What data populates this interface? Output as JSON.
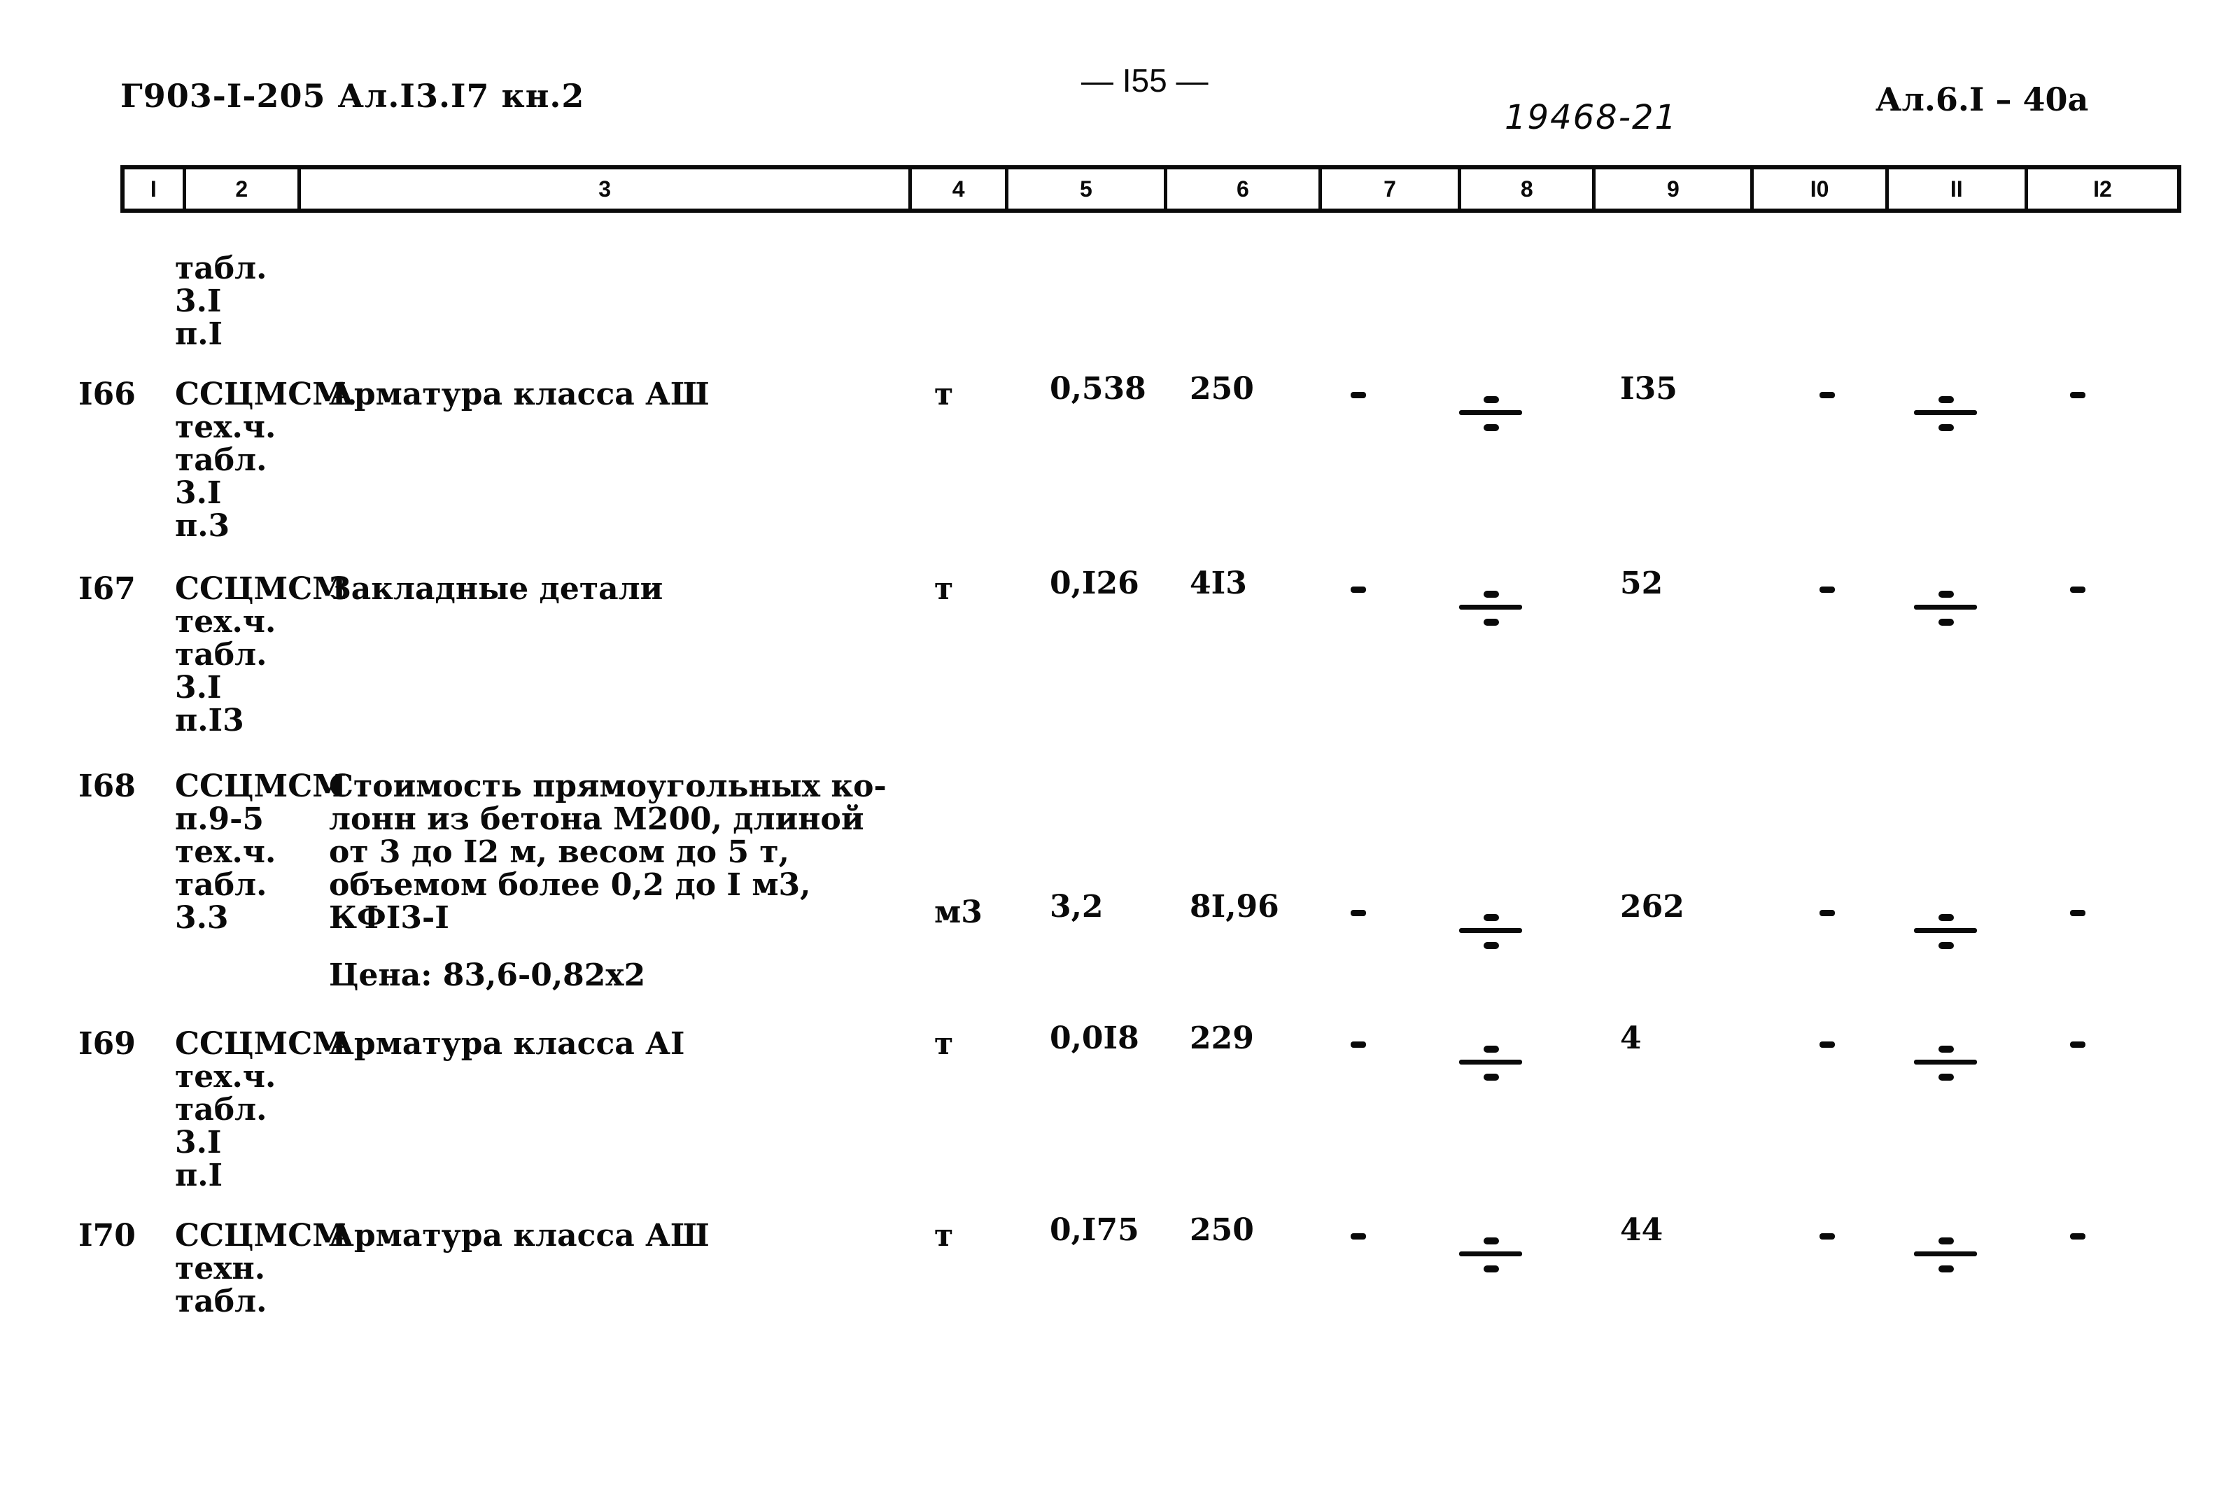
{
  "header": {
    "doc_code": "Г903-I-205 Ал.I3.I7 кн.2",
    "page_number": "— I55 —",
    "handwritten_number": "19468-21",
    "sheet_ref": "Ал.6.I – 40а"
  },
  "columns": [
    "I",
    "2",
    "3",
    "4",
    "5",
    "6",
    "7",
    "8",
    "9",
    "I0",
    "II",
    "I2"
  ],
  "continuation": {
    "ref_lines": "табл.\n3.I\nп.I"
  },
  "rows": [
    {
      "num": "I66",
      "ref": "ССЦМСМ.\nтех.ч.\nтабл.\n3.I\nп.3",
      "description": "Арматура класса АШ",
      "unit": "т",
      "quantity": "0,538",
      "price": "250",
      "col7": "–",
      "col8": "fraction-dash",
      "col9": "I35",
      "col10": "–",
      "col11": "fraction-dash",
      "col12": "–"
    },
    {
      "num": "I67",
      "ref": "ССЦМСМ\nтех.ч.\nтабл.\n3.I\nп.I3",
      "description": "Закладные детали",
      "unit": "т",
      "quantity": "0,I26",
      "price": "4I3",
      "col7": "–",
      "col8": "fraction-dash",
      "col9": "52",
      "col10": "–",
      "col11": "fraction-dash",
      "col12": "–"
    },
    {
      "num": "I68",
      "ref": "ССЦМСМ\nп.9-5\nтех.ч.\nтабл.\n3.3",
      "description": "Стоимость прямоугольных ко-\nлонн из бетона М200, длиной\nот 3 до I2 м, весом до 5 т,\nобъемом более 0,2 до I м3,\nКФI3-I",
      "note": "Цена: 83,6-0,82х2",
      "unit": "м3",
      "quantity": "3,2",
      "price": "8I,96",
      "col7": "–",
      "col8": "fraction-dash",
      "col9": "262",
      "col10": "–",
      "col11": "fraction-dash",
      "col12": "–"
    },
    {
      "num": "I69",
      "ref": "ССЦМСМ\nтех.ч.\nтабл.\n3.I\nп.I",
      "description": "Арматура класса АI",
      "unit": "т",
      "quantity": "0,0I8",
      "price": "229",
      "col7": "–",
      "col8": "fraction-dash",
      "col9": "4",
      "col10": "–",
      "col11": "fraction-dash",
      "col12": "–"
    },
    {
      "num": "I70",
      "ref": "ССЦМСМ\nтехн.\nтабл.",
      "description": "Арматура класса АШ",
      "unit": "т",
      "quantity": "0,I75",
      "price": "250",
      "col7": "–",
      "col8": "fraction-dash",
      "col9": "44",
      "col10": "–",
      "col11": "fraction-dash",
      "col12": "–"
    }
  ]
}
